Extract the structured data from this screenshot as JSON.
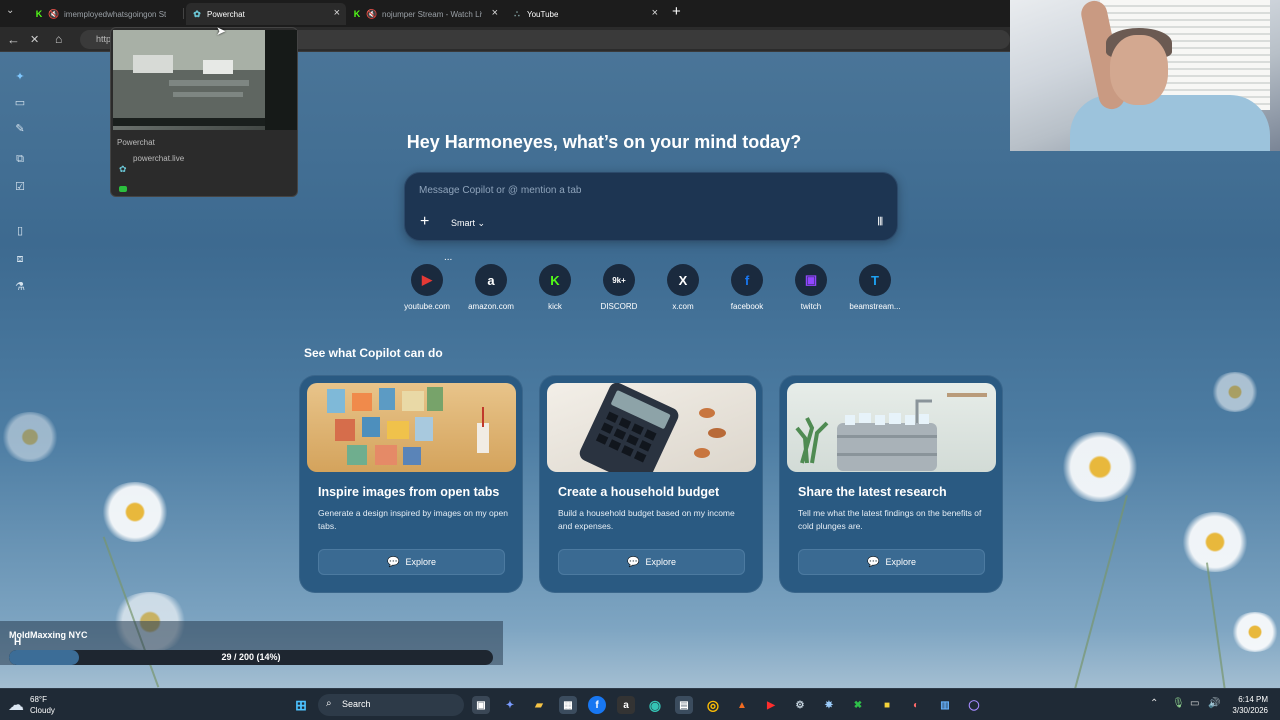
{
  "tabs": [
    {
      "title": "imemployedwhatsgoingon St",
      "icon": "kick-icon"
    },
    {
      "title": "Powerchat",
      "icon": "powerchat-icon"
    },
    {
      "title": "nojumper Stream - Watch Liv",
      "icon": "kick-icon"
    },
    {
      "title": "YouTube",
      "icon": "youtube-icon"
    }
  ],
  "address": {
    "text": "http"
  },
  "tab_preview": {
    "name": "Powerchat",
    "url": "powerchat.live"
  },
  "copilot": {
    "greeting": "Hey Harmoneyes, what’s on your mind today?",
    "placeholder": "Message Copilot or @ mention a tab",
    "mode": "Smart",
    "more": "..."
  },
  "shortcuts": [
    {
      "label": "youtube.com",
      "glyph": "▶",
      "color": "#e53935"
    },
    {
      "label": "amazon.com",
      "glyph": "a",
      "color": "#ffffff"
    },
    {
      "label": "kick",
      "glyph": "K",
      "color": "#53fc18"
    },
    {
      "label": "DISCORD",
      "glyph": "9k+",
      "color": "#ffffff"
    },
    {
      "label": "x.com",
      "glyph": "X",
      "color": "#ffffff"
    },
    {
      "label": "facebook",
      "glyph": "f",
      "color": "#1877f2"
    },
    {
      "label": "twitch",
      "glyph": "▣",
      "color": "#9146ff"
    },
    {
      "label": "beamstream...",
      "glyph": "T",
      "color": "#1da1f2"
    }
  ],
  "section_title": "See what Copilot can do",
  "cards": [
    {
      "title": "Inspire images from open tabs",
      "desc": "Generate a design inspired by images on my open tabs.",
      "button": "Explore"
    },
    {
      "title": "Create a household budget",
      "desc": "Build a household budget based on my income and expenses.",
      "button": "Explore"
    },
    {
      "title": "Share the latest research",
      "desc": "Tell me what the latest findings on the benefits of cold plunges are.",
      "button": "Explore"
    }
  ],
  "stream_overlay": {
    "name": "MoldMaxxing NYC",
    "badge": "H",
    "progress_text": "29 / 200 (14%)",
    "progress": 0.145
  },
  "taskbar": {
    "temp": "68°F",
    "condition": "Cloudy",
    "search": "Search",
    "time": "6:14 PM",
    "date": "3/30/2026"
  }
}
